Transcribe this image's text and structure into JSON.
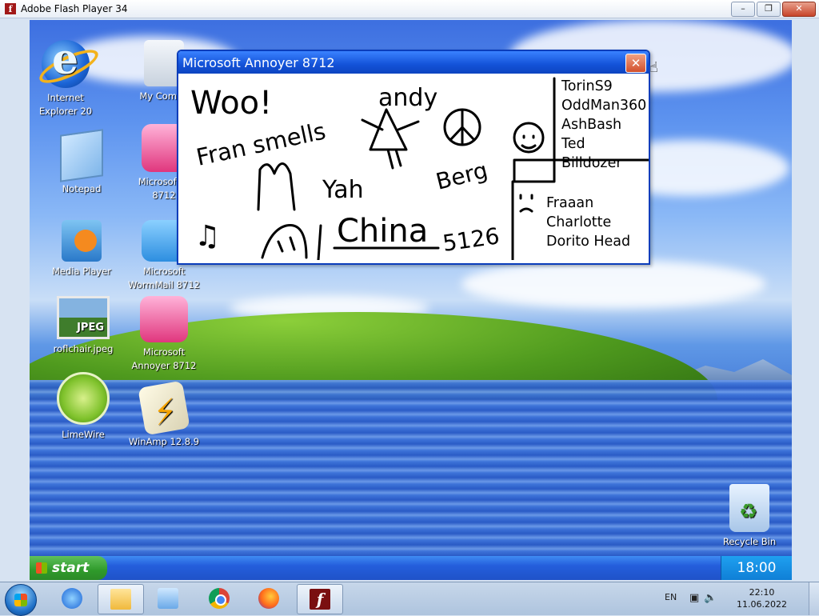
{
  "host_window": {
    "title": "Adobe Flash Player 34",
    "minimize": "–",
    "maximize": "❐",
    "close": "✕"
  },
  "desktop": {
    "icons": [
      {
        "label_1": "Internet",
        "label_2": "Explorer 20"
      },
      {
        "label_1": "My Compu",
        "label_2": ""
      },
      {
        "label_1": "Notepad",
        "label_2": ""
      },
      {
        "label_1": "Microsoft N",
        "label_2": "8712"
      },
      {
        "label_1": "Media Player",
        "label_2": ""
      },
      {
        "label_1": "Microsoft",
        "label_2": "WormMail 8712"
      },
      {
        "label_1": "roflchair.jpeg",
        "label_2": ""
      },
      {
        "label_1": "Microsoft",
        "label_2": "Annoyer 8712"
      },
      {
        "label_1": "LimeWire",
        "label_2": ""
      },
      {
        "label_1": "WinAmp 12.8.9",
        "label_2": ""
      },
      {
        "label_1": "Recycle Bin",
        "label_2": ""
      }
    ],
    "jpeg_badge": "JPEG"
  },
  "dialog": {
    "title": "Microsoft Annoyer 8712",
    "close": "✕",
    "scribbles": {
      "woo": "Woo!",
      "andy": "andy",
      "fran": "Fran smells",
      "yah": "Yah",
      "berg": "Berg",
      "china": "China",
      "num": "5126",
      "note": "♫"
    },
    "names_top": [
      "TorinS9",
      "OddMan360",
      "AshBash",
      "Ted",
      "Billdozer"
    ],
    "names_sad": [
      "Fraaan",
      "Charlotte",
      "Dorito Head"
    ]
  },
  "xp_taskbar": {
    "start": "start",
    "clock": "18:00"
  },
  "win7_taskbar": {
    "language": "EN",
    "tray_icons": "▣🔈",
    "time": "22:10",
    "date": "11.06.2022"
  }
}
